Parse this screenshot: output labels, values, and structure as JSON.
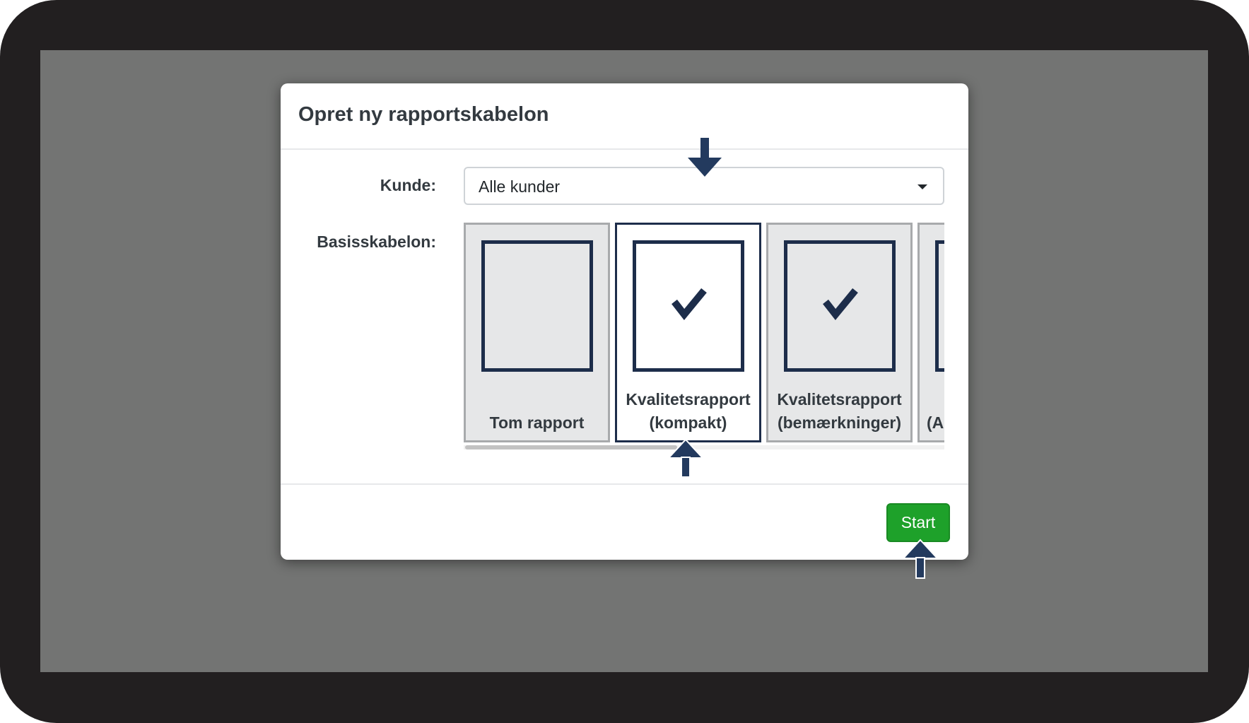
{
  "dialog": {
    "title": "Opret ny rapportskabelon",
    "customer_label": "Kunde:",
    "customer_value": "Alle kunder",
    "template_label": "Basisskabelon:",
    "templates": [
      {
        "line1": "Tom rapport",
        "line2": "",
        "checked": false,
        "selected": false
      },
      {
        "line1": "Kvalitetsrapport",
        "line2": "(kompakt)",
        "checked": true,
        "selected": true
      },
      {
        "line1": "Kvalitetsrapport",
        "line2": "(bemærkninger)",
        "checked": true,
        "selected": false
      },
      {
        "line1": "",
        "line2": "(A",
        "checked": false,
        "selected": false
      }
    ],
    "start_label": "Start"
  },
  "colors": {
    "primary": "#1ea12a",
    "tile_border_selected": "#1d2d4a",
    "arrow": "#233a5e"
  },
  "icons": [
    "check-icon",
    "chevron-down-icon",
    "arrow-down-icon",
    "arrow-up-icon"
  ]
}
